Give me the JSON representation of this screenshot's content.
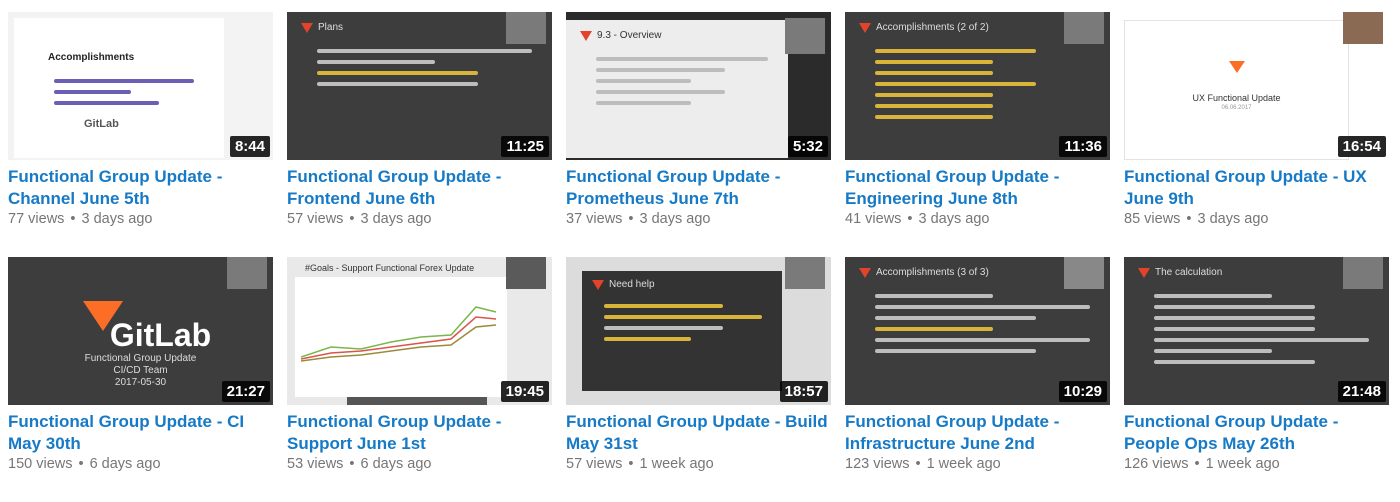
{
  "videos": [
    {
      "title": "Functional Group Update - Channel June 5th",
      "views": "77 views",
      "age": "3 days ago",
      "duration": "8:44"
    },
    {
      "title": "Functional Group Update - Frontend June 6th",
      "views": "57 views",
      "age": "3 days ago",
      "duration": "11:25"
    },
    {
      "title": "Functional Group Update - Prometheus June 7th",
      "views": "37 views",
      "age": "3 days ago",
      "duration": "5:32"
    },
    {
      "title": "Functional Group Update - Engineering June 8th",
      "views": "41 views",
      "age": "3 days ago",
      "duration": "11:36"
    },
    {
      "title": "Functional Group Update - UX June 9th",
      "views": "85 views",
      "age": "3 days ago",
      "duration": "16:54"
    },
    {
      "title": "Functional Group Update - CI May 30th",
      "views": "150 views",
      "age": "6 days ago",
      "duration": "21:27"
    },
    {
      "title": "Functional Group Update - Support June 1st",
      "views": "53 views",
      "age": "6 days ago",
      "duration": "19:45"
    },
    {
      "title": "Functional Group Update - Build May 31st",
      "views": "57 views",
      "age": "1 week ago",
      "duration": "18:57"
    },
    {
      "title": "Functional Group Update - Infrastructure June 2nd",
      "views": "123 views",
      "age": "1 week ago",
      "duration": "10:29"
    },
    {
      "title": "Functional Group Update - People Ops May 26th",
      "views": "126 views",
      "age": "1 week ago",
      "duration": "21:48"
    }
  ],
  "thumbs": {
    "t1": {
      "heading": "Accomplishments",
      "logo": "GitLab"
    },
    "t2": {
      "heading": "Plans"
    },
    "t3": {
      "heading": "9.3 - Overview"
    },
    "t4": {
      "heading": "Accomplishments (2 of 2)"
    },
    "t5": {
      "heading": "UX Functional Update",
      "date": "06.06.2017"
    },
    "t6": {
      "logo": "GitLab",
      "sub1": "Functional Group Update",
      "sub2": "CI/CD Team",
      "sub3": "2017-05-30"
    },
    "t7": {
      "heading": "#Goals - Support Functional Forex Update"
    },
    "t8": {
      "heading": "Need help"
    },
    "t9": {
      "heading": "Accomplishments (3 of 3)"
    },
    "t10": {
      "heading": "The calculation"
    }
  },
  "colors": {
    "link": "#167ac6",
    "meta": "#767676",
    "accent": "#fc6d26"
  }
}
